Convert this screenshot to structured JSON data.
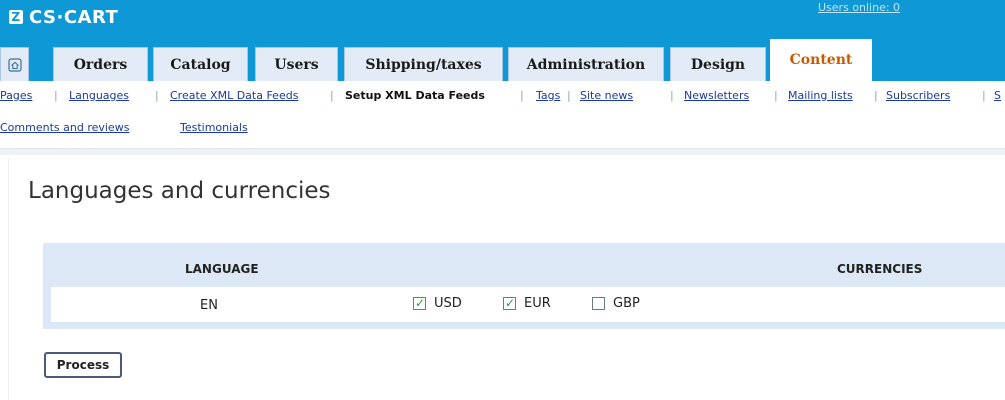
{
  "header": {
    "logo_text": "CS·CART",
    "logo_mark": "Z",
    "users_online": "Users online: 0",
    "brand_color": "#0e98d6"
  },
  "tabs": [
    {
      "label": "",
      "icon": "home-icon"
    },
    {
      "label": "Orders"
    },
    {
      "label": "Catalog"
    },
    {
      "label": "Users"
    },
    {
      "label": "Shipping/taxes"
    },
    {
      "label": "Administration"
    },
    {
      "label": "Design"
    },
    {
      "label": "Content",
      "active": true
    }
  ],
  "subnav": {
    "row1": [
      "Pages",
      "Languages",
      "Create XML Data Feeds",
      "Setup XML Data Feeds",
      "Tags",
      "Site news",
      "Newsletters",
      "Mailing lists",
      "Subscribers",
      "S"
    ],
    "current": "Setup XML Data Feeds",
    "row2": [
      "Comments and reviews",
      "Testimonials"
    ]
  },
  "page": {
    "title": "Languages and currencies"
  },
  "table": {
    "headers": {
      "language": "LANGUAGE",
      "currencies": "CURRENCIES"
    },
    "row": {
      "language": "EN",
      "currencies": [
        {
          "code": "USD",
          "checked": true
        },
        {
          "code": "EUR",
          "checked": true
        },
        {
          "code": "GBP",
          "checked": false
        }
      ]
    }
  },
  "actions": {
    "process_label": "Process"
  }
}
